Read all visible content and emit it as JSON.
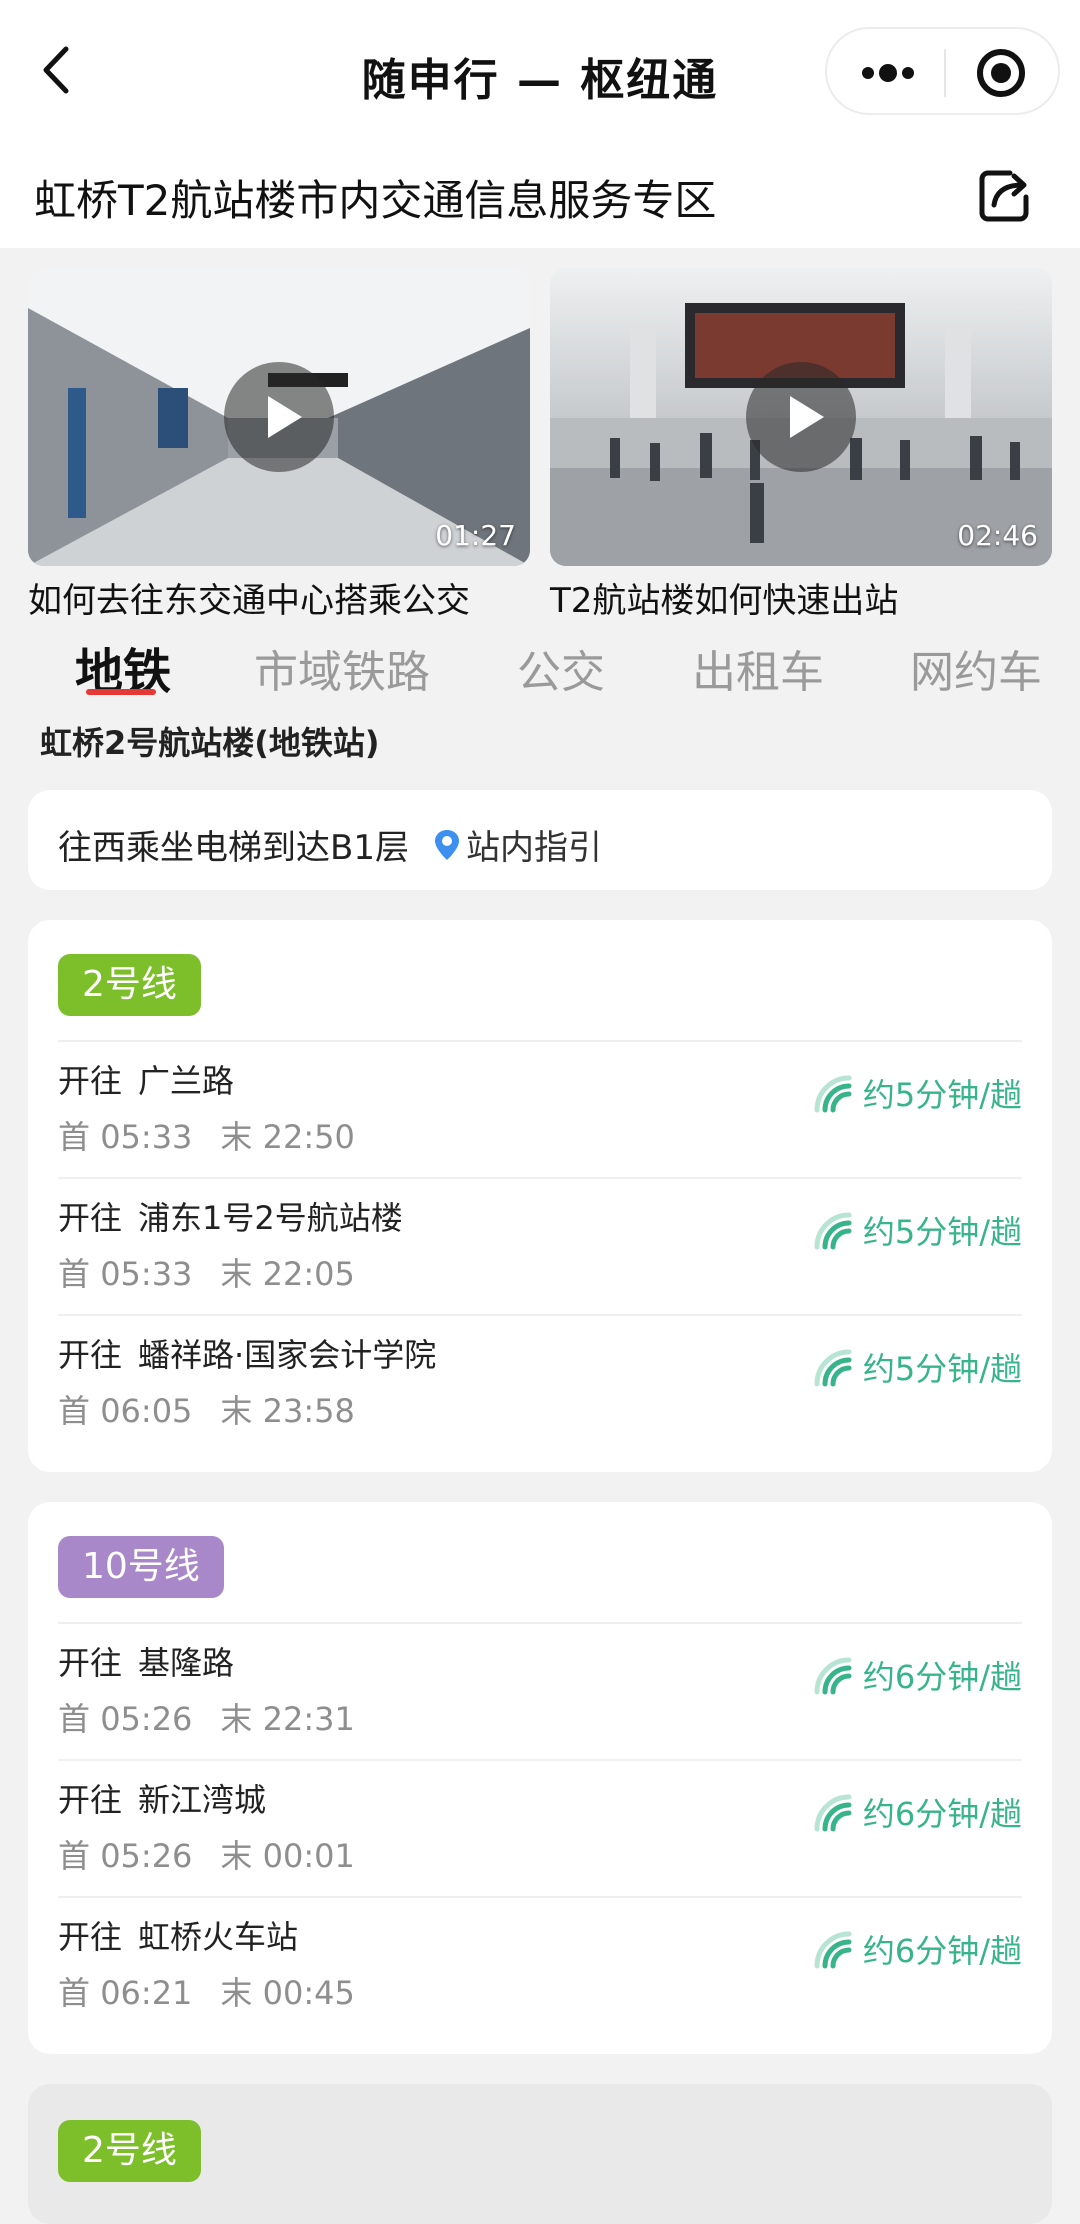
{
  "app_title": "随申行 — 枢纽通",
  "page_title": "虹桥T2航站楼市内交通信息服务专区",
  "videos": [
    {
      "duration": "01:27",
      "caption": "如何去往东交通中心搭乘公交"
    },
    {
      "duration": "02:46",
      "caption": "T2航站楼如何快速出站"
    }
  ],
  "tabs": [
    "地铁",
    "市域铁路",
    "公交",
    "出租车",
    "网约车"
  ],
  "active_tab": "地铁",
  "station_name": "虹桥2号航站楼(地铁站)",
  "guide": {
    "text": "往西乘坐电梯到达B1层",
    "link_label": "站内指引",
    "link_icon": "location-pin-icon"
  },
  "direction_label": "开往",
  "first_prefix": "首",
  "last_prefix": "末",
  "lines": [
    {
      "name": "2号线",
      "color": "#7dbf2a",
      "routes": [
        {
          "dest": "广兰路",
          "first": "05:33",
          "last": "22:50",
          "freq": "约5分钟/趟"
        },
        {
          "dest": "浦东1号2号航站楼",
          "first": "05:33",
          "last": "22:05",
          "freq": "约5分钟/趟"
        },
        {
          "dest": "蟠祥路·国家会计学院",
          "first": "06:05",
          "last": "23:58",
          "freq": "约5分钟/趟"
        }
      ]
    },
    {
      "name": "10号线",
      "color": "#a988c9",
      "routes": [
        {
          "dest": "基隆路",
          "first": "05:26",
          "last": "22:31",
          "freq": "约6分钟/趟"
        },
        {
          "dest": "新江湾城",
          "first": "05:26",
          "last": "00:01",
          "freq": "约6分钟/趟"
        },
        {
          "dest": "虹桥火车站",
          "first": "06:21",
          "last": "00:45",
          "freq": "约6分钟/趟"
        }
      ]
    },
    {
      "name": "2号线",
      "color": "#7dbf2a",
      "routes": []
    }
  ],
  "colors": {
    "accent_green": "#38b48b",
    "tab_underline": "#e53935",
    "guide_icon": "#3d8ff0"
  }
}
